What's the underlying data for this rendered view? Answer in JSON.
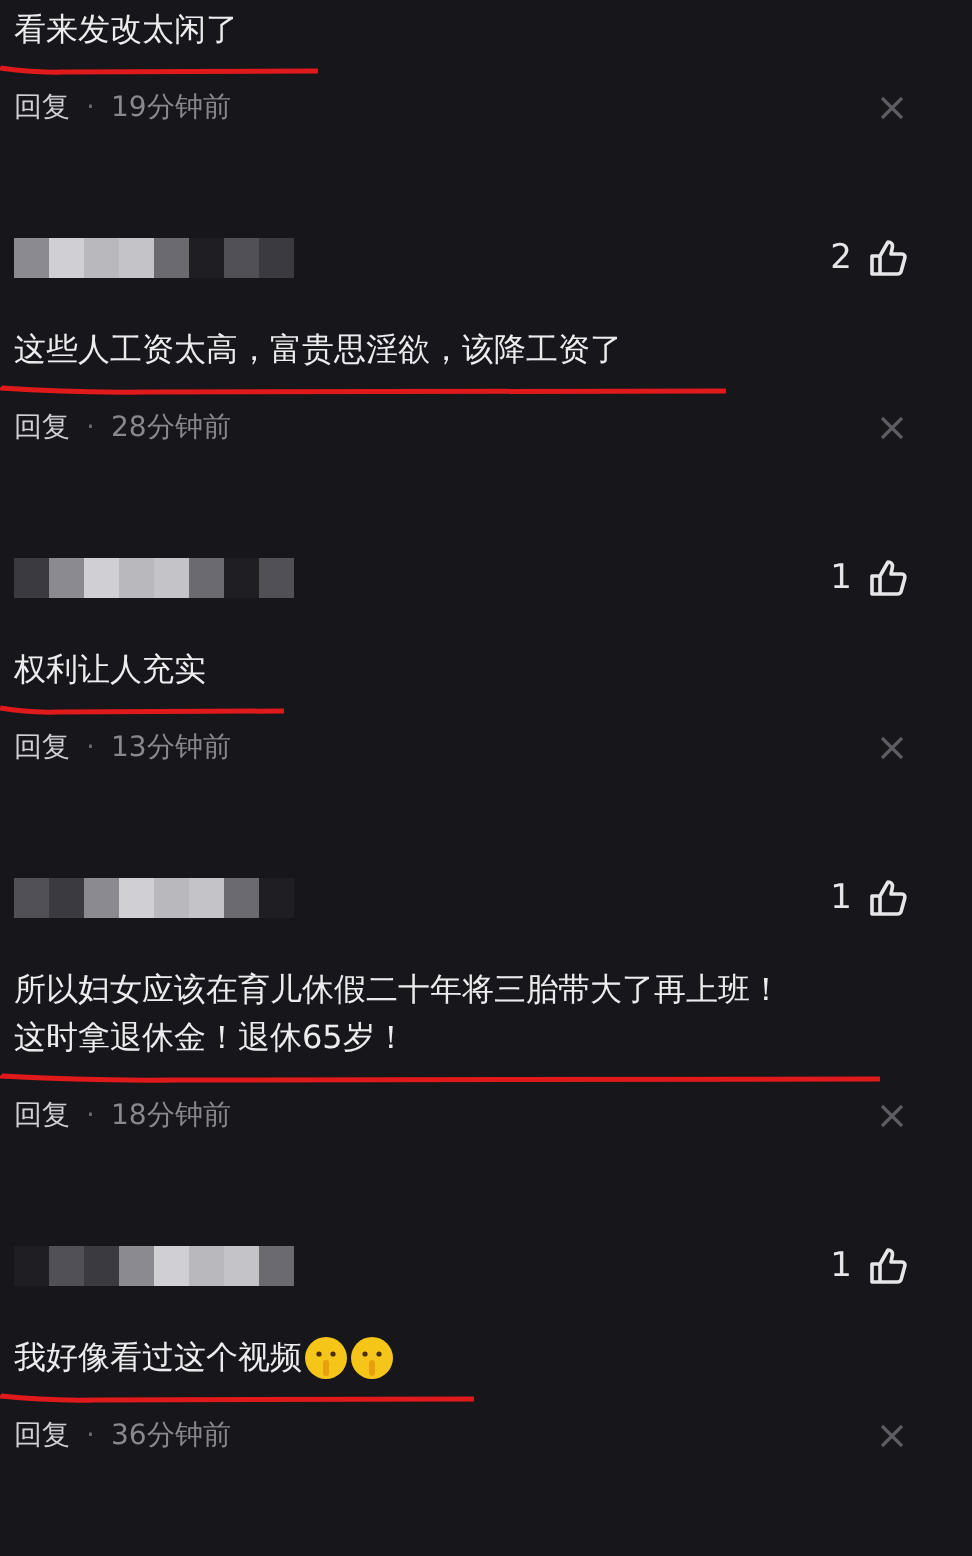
{
  "comments": [
    {
      "text_lines": [
        "看来发改太闲了"
      ],
      "underlined": true,
      "reply_label": "回复",
      "separator": "·",
      "time": "19分钟前"
    },
    {
      "username_hidden": true,
      "likes": "2",
      "text_lines": [
        "这些人工资太高，富贵思淫欲，该降工资了"
      ],
      "underlined": true,
      "reply_label": "回复",
      "separator": "·",
      "time": "28分钟前"
    },
    {
      "username_hidden": true,
      "likes": "1",
      "text_lines": [
        "权利让人充实"
      ],
      "underlined": true,
      "reply_label": "回复",
      "separator": "·",
      "time": "13分钟前"
    },
    {
      "username_hidden": true,
      "likes": "1",
      "text_lines": [
        "所以妇女应该在育儿休假二十年将三胎带大了再上班！",
        "这时拿退休金！退休65岁！"
      ],
      "underlined": true,
      "reply_label": "回复",
      "separator": "·",
      "time": "18分钟前"
    },
    {
      "username_hidden": true,
      "likes": "1",
      "text_lines": [
        "我好像看过这个视频"
      ],
      "emojis": [
        {
          "kind": "shush"
        },
        {
          "kind": "shush"
        }
      ],
      "underlined": true,
      "reply_label": "回复",
      "separator": "·",
      "time": "36分钟前"
    }
  ]
}
